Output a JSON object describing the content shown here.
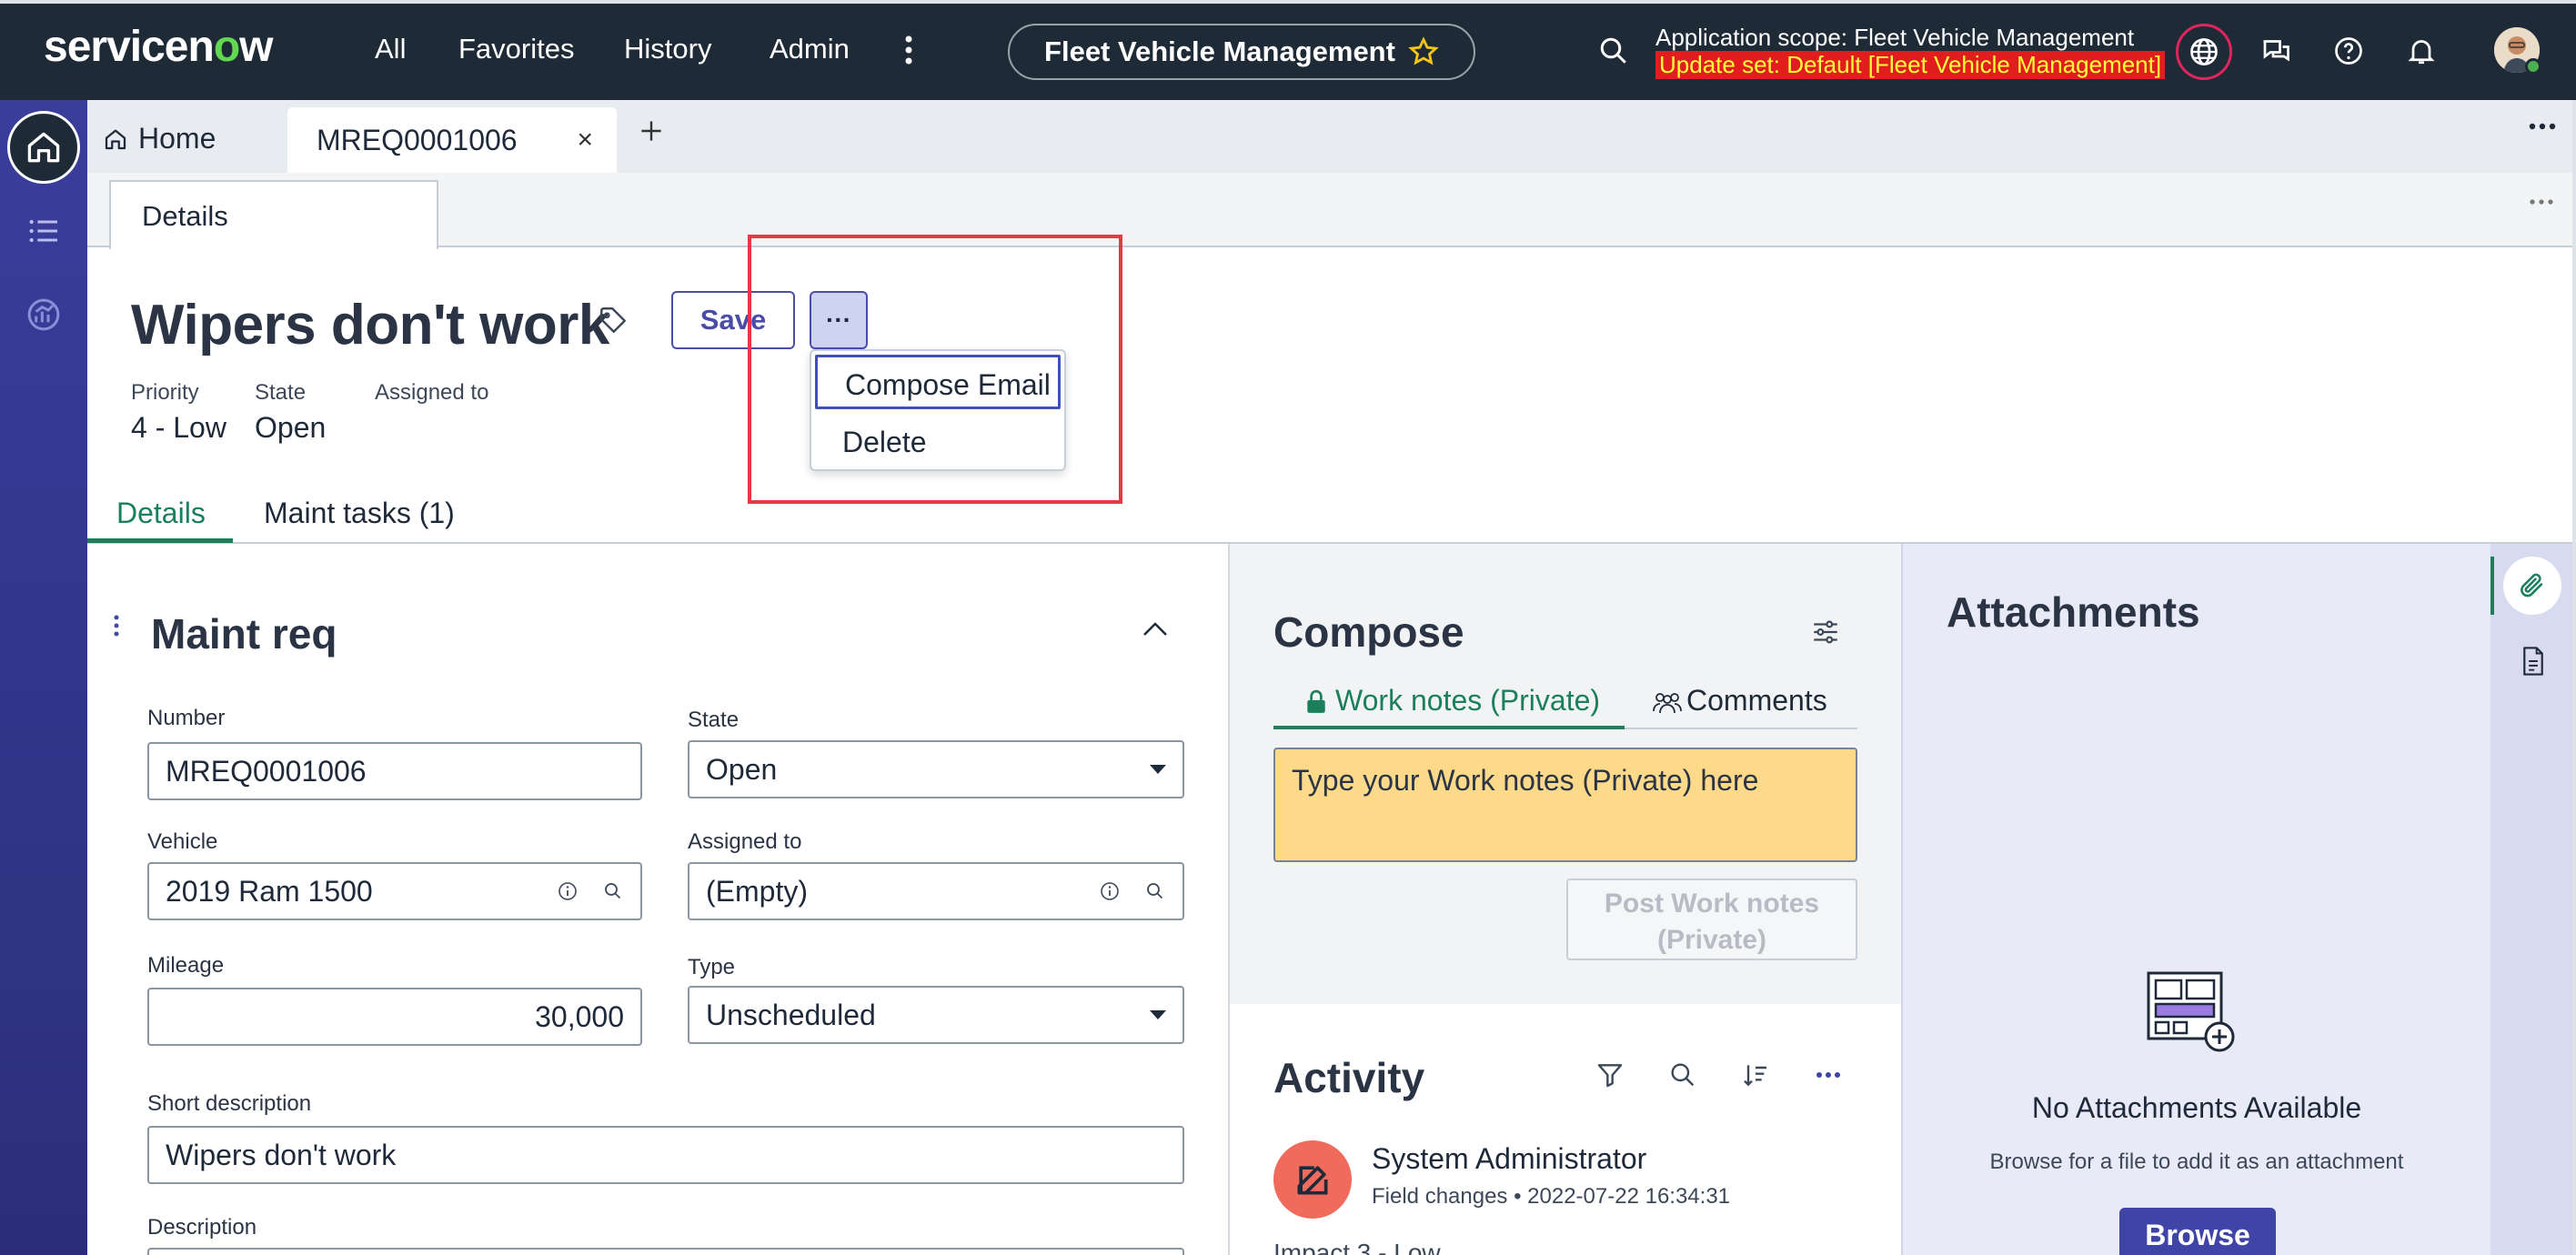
{
  "header": {
    "logo_text_a": "servicen",
    "logo_text_b": "o",
    "logo_text_c": "w",
    "nav": [
      "All",
      "Favorites",
      "History",
      "Admin"
    ],
    "app_pill": "Fleet Vehicle Management",
    "scope_line": "Application scope: Fleet Vehicle Management",
    "update_set_line": "Update set: Default [Fleet Vehicle Management]"
  },
  "tabs": {
    "home_label": "Home",
    "record_tab_label": "MREQ0001006"
  },
  "subtabs": {
    "details_label": "Details"
  },
  "record": {
    "title": "Wipers don't work",
    "save_label": "Save",
    "more_label": "···",
    "meta": [
      {
        "label": "Priority",
        "value": "4 - Low"
      },
      {
        "label": "State",
        "value": "Open"
      },
      {
        "label": "Assigned to",
        "value": ""
      }
    ]
  },
  "dropdown": {
    "items": [
      "Compose Email",
      "Delete"
    ]
  },
  "content_tabs": {
    "details": "Details",
    "maint_tasks": "Maint tasks (1)"
  },
  "form": {
    "title": "Maint req",
    "fields": {
      "number": {
        "label": "Number",
        "value": "MREQ0001006"
      },
      "state": {
        "label": "State",
        "value": "Open"
      },
      "vehicle": {
        "label": "Vehicle",
        "value": "2019 Ram 1500"
      },
      "assigned_to": {
        "label": "Assigned to",
        "value": "(Empty)"
      },
      "mileage": {
        "label": "Mileage",
        "value": "30,000"
      },
      "type": {
        "label": "Type",
        "value": "Unscheduled"
      },
      "short_description": {
        "label": "Short description",
        "value": "Wipers don't work"
      },
      "description": {
        "label": "Description"
      }
    }
  },
  "compose": {
    "title": "Compose",
    "tab_worknotes": "Work notes (Private)",
    "tab_comments": "Comments",
    "placeholder": "Type your Work notes (Private) here",
    "post_line1": "Post Work notes",
    "post_line2": "(Private)"
  },
  "activity": {
    "title": "Activity",
    "entry_name": "System Administrator",
    "entry_meta": "Field changes • 2022-07-22 16:34:31",
    "partial_row": "Impact        3 - Low"
  },
  "attachments": {
    "title": "Attachments",
    "empty_title": "No Attachments Available",
    "empty_hint": "Browse for a file to add it as an attachment",
    "browse_label": "Browse"
  },
  "colors": {
    "header_bg": "#1f2a37",
    "rail_bg": "#3b3d9c",
    "accent_green": "#1a7f5a",
    "worknotes_bg": "#fdd98a",
    "highlight_red": "#e63946",
    "browse_bg": "#3f45a6"
  }
}
